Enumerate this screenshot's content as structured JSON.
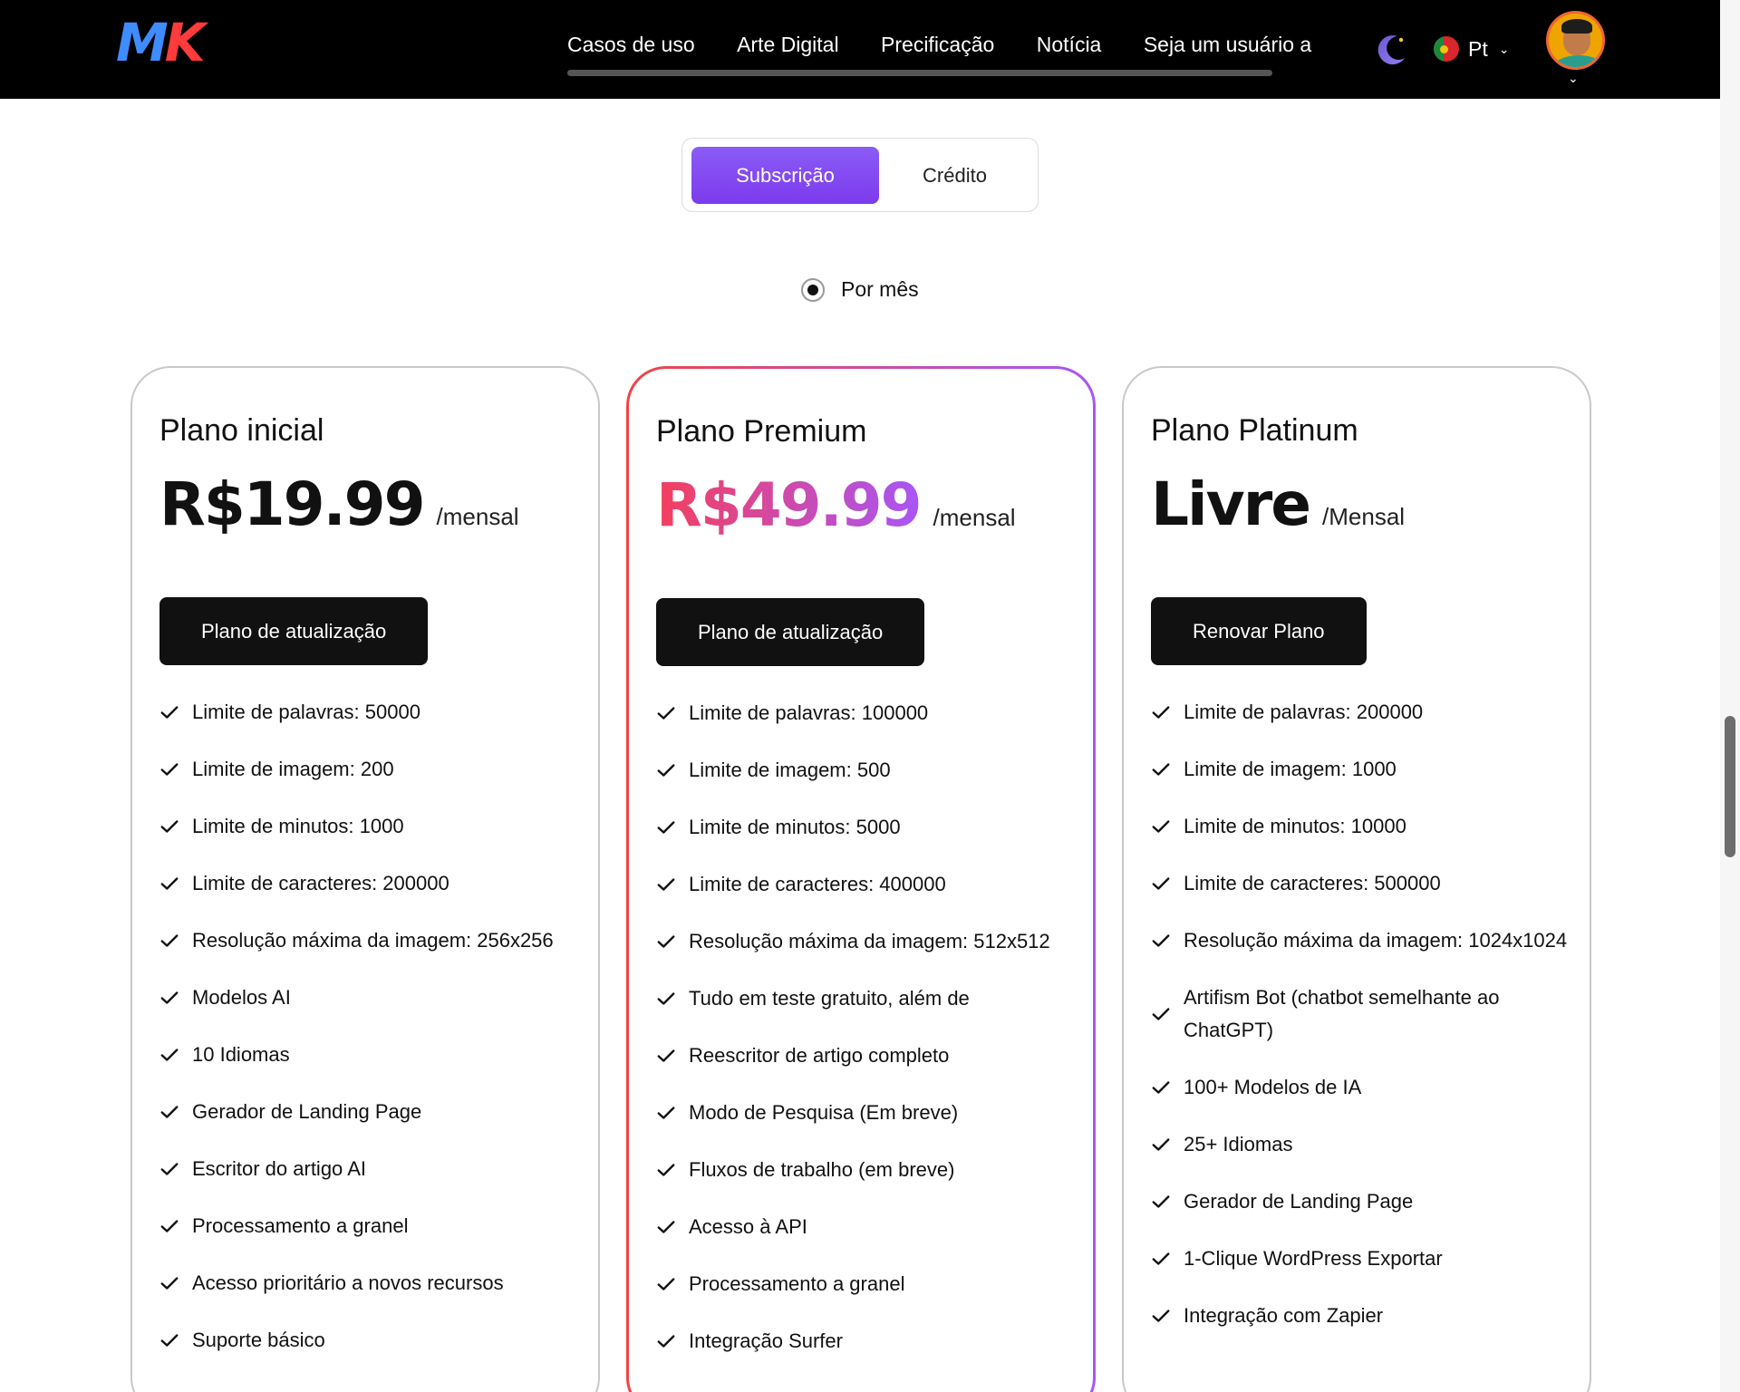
{
  "header": {
    "logo": {
      "part1": "M",
      "part2": "K"
    },
    "nav": [
      "Casos de uso",
      "Arte Digital",
      "Precificação",
      "Notícia",
      "Seja um usuário a"
    ],
    "language": "Pt",
    "icons": {
      "theme": "moon-icon",
      "flag": "portugal-flag-icon",
      "dropdown": "chevron-down-icon"
    }
  },
  "toggle": {
    "active": "Subscrição",
    "inactive": "Crédito"
  },
  "billing": {
    "label": "Por mês",
    "selected": true
  },
  "colors": {
    "accent_purple": "#7c3aed",
    "gradient_start": "#f43f5e",
    "gradient_end": "#a855f7",
    "button_bg": "#111111",
    "header_bg": "#000000"
  },
  "plans": [
    {
      "name": "Plano inicial",
      "price": "R$19.99",
      "period": "/mensal",
      "button": "Plano de atualização",
      "features": [
        "Limite de palavras: 50000",
        "Limite de imagem: 200",
        "Limite de minutos: 1000",
        "Limite de caracteres: 200000",
        "Resolução máxima da imagem: 256x256",
        "Modelos AI",
        "10 Idiomas",
        "Gerador de Landing Page",
        "Escritor do artigo AI",
        "Processamento a granel",
        "Acesso prioritário a novos recursos",
        "Suporte básico"
      ]
    },
    {
      "name": "Plano Premium",
      "price": "R$49.99",
      "period": "/mensal",
      "button": "Plano de atualização",
      "features": [
        "Limite de palavras: 100000",
        "Limite de imagem: 500",
        "Limite de minutos: 5000",
        "Limite de caracteres: 400000",
        "Resolução máxima da imagem: 512x512",
        "Tudo em teste gratuito, além de",
        "Reescritor de artigo completo",
        "Modo de Pesquisa (Em breve)",
        "Fluxos de trabalho (em breve)",
        "Acesso à API",
        "Processamento a granel",
        "Integração Surfer"
      ]
    },
    {
      "name": "Plano Platinum",
      "price": "Livre",
      "period": "/Mensal",
      "button": "Renovar Plano",
      "features": [
        "Limite de palavras: 200000",
        "Limite de imagem: 1000",
        "Limite de minutos: 10000",
        "Limite de caracteres: 500000",
        "Resolução máxima da imagem: 1024x1024",
        "Artifism Bot (chatbot semelhante ao ChatGPT)",
        "100+ Modelos de IA",
        "25+ Idiomas",
        "Gerador de Landing Page",
        "1-Clique WordPress Exportar",
        "Integração com Zapier"
      ]
    }
  ]
}
